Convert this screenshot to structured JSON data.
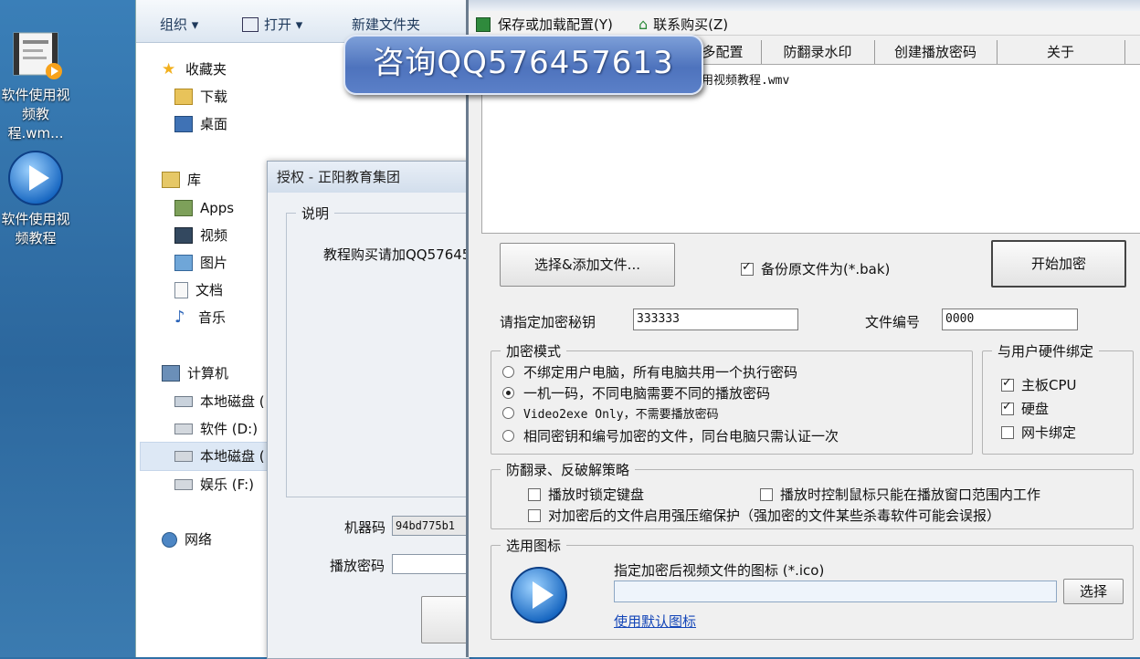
{
  "desktop": {
    "icons": [
      {
        "label_line1": "软件使用视",
        "label_line2": "频教程.wm..."
      },
      {
        "label_line1": "软件使用视",
        "label_line2": "频教程"
      }
    ]
  },
  "explorer": {
    "toolbar": {
      "organize": "组织 ▾",
      "open": "打开 ▾",
      "new_folder": "新建文件夹"
    },
    "nav": {
      "favorites": "收藏夹",
      "downloads": "下载",
      "desktop": "桌面",
      "libraries": "库",
      "apps": "Apps",
      "videos": "视频",
      "pictures": "图片",
      "documents": "文档",
      "music": "音乐",
      "computer": "计算机",
      "local_disk_1": "本地磁盘 (",
      "software_d": "软件 (D:)",
      "local_disk_2": "本地磁盘 (",
      "entertainment_f": "娱乐 (F:)",
      "network": "网络"
    }
  },
  "auth_dialog": {
    "title": "授权 - 正阳教育集团",
    "group_label": "说明",
    "description": "教程购买请加QQ57645",
    "machine_code_label": "机器码",
    "machine_code_value": "94bd775b1",
    "play_password_label": "播放密码",
    "play_password_value": ""
  },
  "app": {
    "menu": {
      "save_load": "保存或加载配置(Y)",
      "contact_buy": "联系购买(Z)"
    },
    "tabs": [
      "多配置",
      "防翻录水印",
      "创建播放密码",
      "关于"
    ],
    "file_list": {
      "row": "用视频教程.wmv"
    },
    "select_add_button": "选择&添加文件...",
    "backup_label": "备份原文件为(*.bak)",
    "start_encrypt_button": "开始加密",
    "key_label": "请指定加密秘钥",
    "key_value": "333333",
    "file_no_label": "文件编号",
    "file_no_value": "0000",
    "mode_group": {
      "label": "加密模式",
      "options": [
        "不绑定用户电脑，所有电脑共用一个执行密码",
        "一机一码，不同电脑需要不同的播放密码",
        "Video2exe Only，不需要播放密码",
        "相同密钥和编号加密的文件，同台电脑只需认证一次"
      ],
      "selected_index": 1
    },
    "hw_group": {
      "label": "与用户硬件绑定",
      "options": [
        "主板CPU",
        "硬盘",
        "网卡绑定"
      ],
      "checked": [
        true,
        true,
        false
      ]
    },
    "anti_group": {
      "label": "防翻录、反破解策略",
      "opt1": "播放时锁定键盘",
      "opt2": "播放时控制鼠标只能在播放窗口范围内工作",
      "opt3": "对加密后的文件启用强压缩保护（强加密的文件某些杀毒软件可能会误报）"
    },
    "icon_group": {
      "label": "选用图标",
      "desc": "指定加密后视频文件的图标 (*.ico)",
      "path_value": "",
      "choose_button": "选择",
      "default_link": "使用默认图标"
    }
  },
  "banner": {
    "text": "咨询QQ576457613"
  }
}
